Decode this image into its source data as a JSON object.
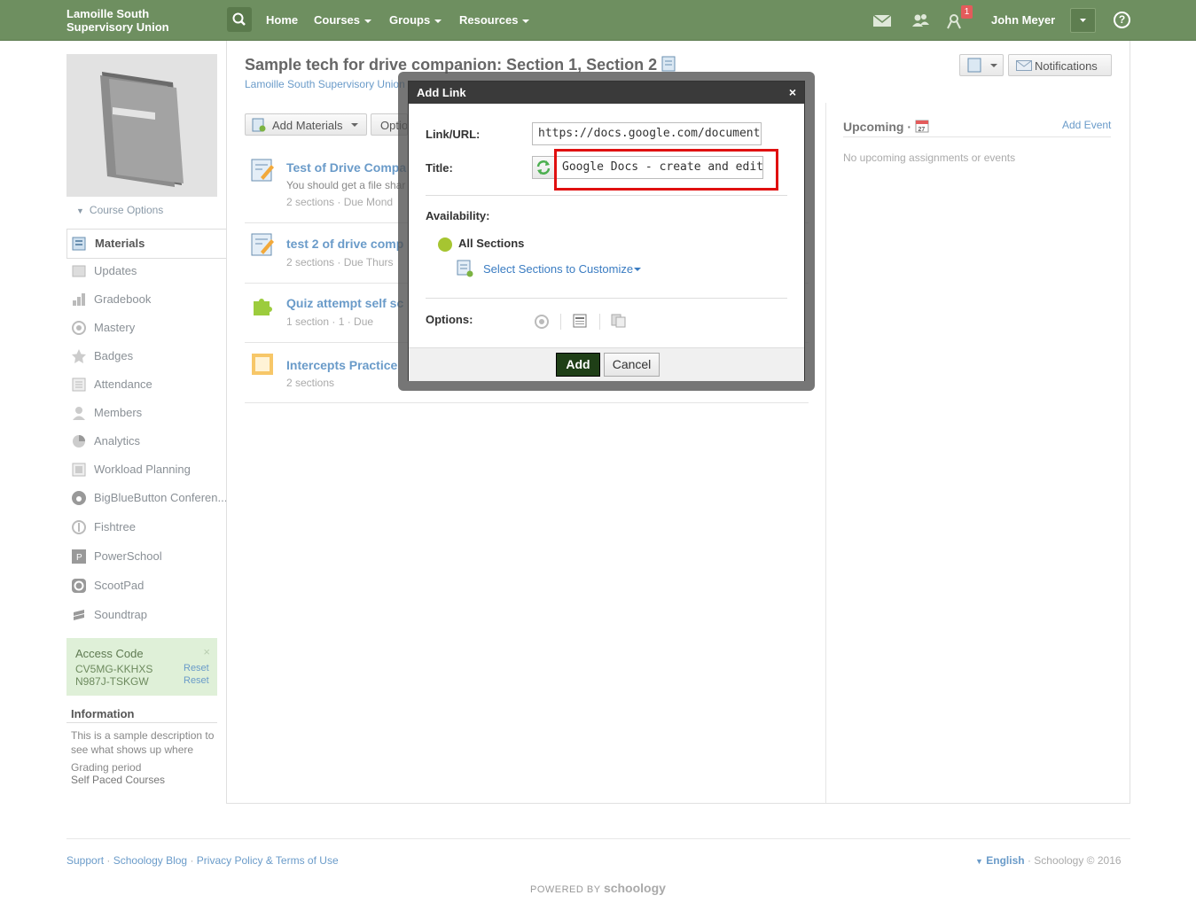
{
  "brand": {
    "line1": "Lamoille South",
    "line2": "Supervisory Union"
  },
  "nav": {
    "home": "Home",
    "courses": "Courses",
    "groups": "Groups",
    "resources": "Resources"
  },
  "header": {
    "user": "John Meyer",
    "notification_count": "1",
    "help": "?"
  },
  "sidebar": {
    "course_options": "Course Options",
    "items": [
      {
        "label": "Materials"
      },
      {
        "label": "Updates"
      },
      {
        "label": "Gradebook"
      },
      {
        "label": "Mastery"
      },
      {
        "label": "Badges"
      },
      {
        "label": "Attendance"
      },
      {
        "label": "Members"
      },
      {
        "label": "Analytics"
      },
      {
        "label": "Workload Planning"
      },
      {
        "label": "BigBlueButton Conferen..."
      },
      {
        "label": "Fishtree"
      },
      {
        "label": "PowerSchool"
      },
      {
        "label": "ScootPad"
      },
      {
        "label": "Soundtrap"
      }
    ],
    "access": {
      "title": "Access Code",
      "codes": [
        "CV5MG-KKHXS",
        "N987J-TSKGW"
      ],
      "reset": "Reset"
    },
    "info": {
      "title": "Information",
      "description_line1": "This is a sample description to",
      "description_line2": "see what shows up where",
      "grading_label": "Grading period",
      "grading_value": "Self Paced Courses"
    }
  },
  "main": {
    "title": "Sample tech for drive companion: Section 1, Section 2",
    "subtitle": "Lamoille South Supervisory Union",
    "add_materials": "Add Materials",
    "options": "Optio",
    "notifications": "Notifications",
    "materials": [
      {
        "title": "Test of Drive Compa",
        "desc": "You should get a file shar",
        "meta": "2 sections · Due Mond"
      },
      {
        "title": "test 2 of drive comp",
        "meta": "2 sections · Due Thurs"
      },
      {
        "title": "Quiz attempt self sc",
        "meta": "1 section · 1 · Due"
      },
      {
        "title": "Intercepts Practice",
        "meta": "2 sections"
      }
    ]
  },
  "upcoming": {
    "title": "Upcoming ·",
    "add_event": "Add Event",
    "empty": "No upcoming assignments or events",
    "calendar_day": "27"
  },
  "modal": {
    "title": "Add Link",
    "close": "×",
    "link_label": "Link/URL:",
    "link_value": "https://docs.google.com/document/d/",
    "title_label": "Title:",
    "title_value": "Google Docs - create and edit doc",
    "availability_label": "Availability:",
    "all_sections": "All Sections",
    "select_sections": "Select Sections to Customize",
    "options_label": "Options:",
    "add": "Add",
    "cancel": "Cancel"
  },
  "footer": {
    "support": "Support",
    "blog": "Schoology Blog",
    "privacy": "Privacy Policy & Terms of Use",
    "language": "English",
    "copyright": "Schoology © 2016",
    "powered_by": "POWERED BY",
    "brand": "schoology"
  },
  "colors": {
    "topbar": "#6e8f60",
    "link": "#6a9bc9",
    "add_button": "#1f3f17",
    "highlight": "#e01010"
  }
}
